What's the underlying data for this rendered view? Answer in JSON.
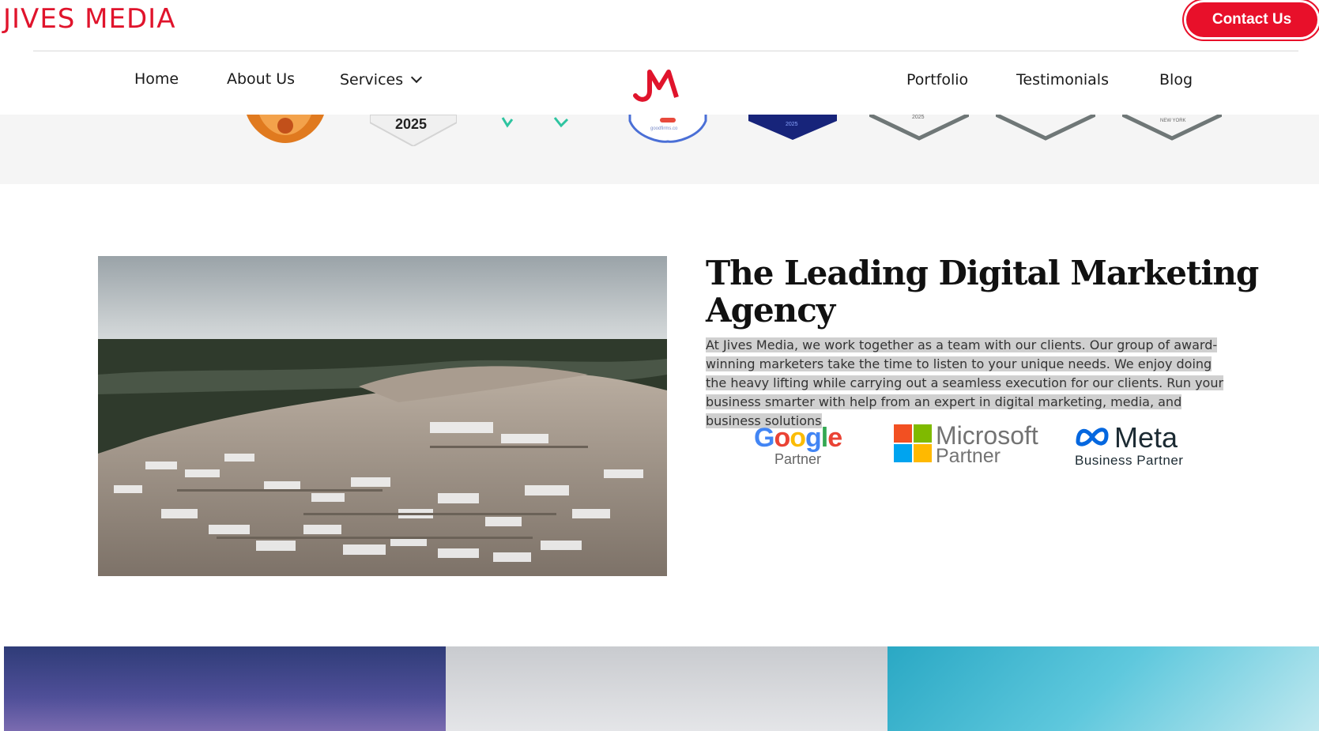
{
  "header": {
    "brand": "JIVES MEDIA",
    "contact_label": "Contact Us"
  },
  "nav": {
    "left": [
      {
        "label": "Home"
      },
      {
        "label": "About Us"
      },
      {
        "label": "Services"
      }
    ],
    "right": [
      {
        "label": "Portfolio"
      },
      {
        "label": "Testimonials"
      },
      {
        "label": "Blog"
      }
    ]
  },
  "badges": {
    "items": [
      {
        "name": "award-wreath-badge",
        "text": ""
      },
      {
        "name": "year-badge",
        "text": "2025"
      },
      {
        "name": "laurel-badge",
        "text": ""
      },
      {
        "name": "goodfirms-badge",
        "text": "goodfirms.co"
      },
      {
        "name": "navy-badge",
        "text": "2025"
      },
      {
        "name": "chevron-badge-1",
        "text": "2025"
      },
      {
        "name": "chevron-badge-2",
        "text": ""
      },
      {
        "name": "chevron-badge-3",
        "text": "NEW YORK"
      }
    ]
  },
  "main": {
    "headline": "The Leading Digital Marketing Agency",
    "blurb": "At Jives Media, we work together as a team with our clients. Our group of award-winning marketers take the time to listen to your unique needs. We enjoy doing the heavy lifting while carrying out a seamless execution for our clients. Run your business smarter with help from an expert in digital marketing, media, and business solutions",
    "image_alt": "Aerial view of a marina with yachts"
  },
  "partners": {
    "google": {
      "name": "Google",
      "sub": "Partner"
    },
    "microsoft": {
      "name": "Microsoft",
      "sub": "Partner"
    },
    "meta": {
      "name": "Meta",
      "sub": "Business Partner"
    }
  },
  "colors": {
    "brand_red": "#e0142c",
    "text_dark": "#111111",
    "badge_strip": "#f5f5f5",
    "highlight": "#d0d0d0"
  }
}
